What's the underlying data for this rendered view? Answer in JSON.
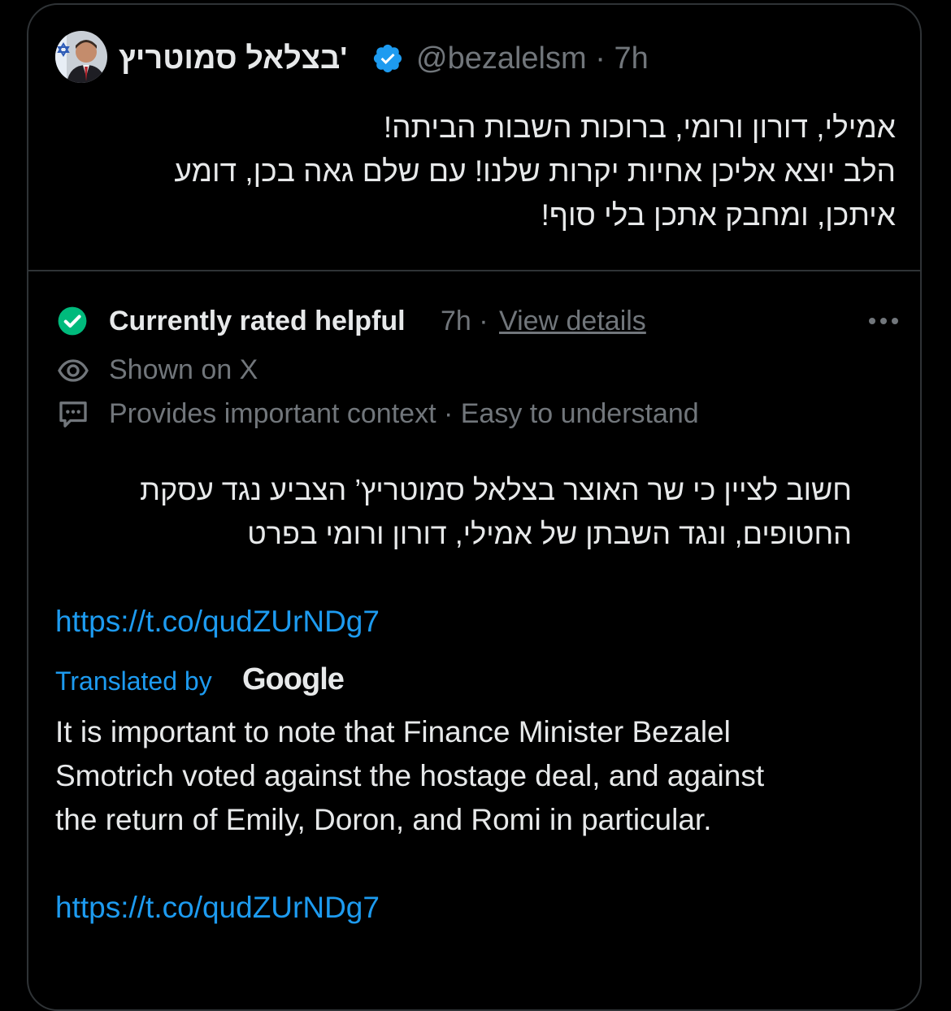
{
  "tweet": {
    "author_name": "בצלאל סמוטריץ'",
    "handle": "@bezalelsm",
    "separator": "·",
    "time": "7h",
    "text_lines": [
      "אמילי, דורון ורומי, ברוכות השבות הביתה!",
      "הלב יוצא אליכן אחיות יקרות שלנו! עם שלם גאה בכן, דומע",
      "איתכן, ומחבק אתכן בלי סוף!"
    ]
  },
  "community_note": {
    "status_label": "Currently rated helpful",
    "time": "7h",
    "separator": "·",
    "view_details_label": "View details",
    "shown_on_label": "Shown on X",
    "reasons_label": "Provides important context · Easy to understand",
    "note_lines_he": [
      "חשוב לציין כי שר האוצר בצלאל סמוטריץ’ הצביע נגד עסקת",
      "החטופים, ונגד השבתן של אמילי, דורון ורומי בפרט"
    ],
    "link_1": "https://t.co/qudZUrNDg7",
    "translated_by_label": "Translated by",
    "translator_logo_text": "Google",
    "translation_lines": [
      "It is important to note that Finance Minister Bezalel",
      "Smotrich voted against the hostage deal, and against",
      "the return of Emily, Doron, and Romi in particular."
    ],
    "link_2": "https://t.co/qudZUrNDg7"
  },
  "icons": {
    "verified": "verified-badge-icon",
    "rated_helpful": "check-circle-icon",
    "shown_on": "eye-icon",
    "reasons": "comment-dots-icon",
    "more": "more-horizontal-icon"
  },
  "colors": {
    "background": "#000000",
    "border": "#2f3336",
    "text_primary": "#e7e9ea",
    "text_secondary": "#71767b",
    "link": "#1d9bf0",
    "verified": "#1d9bf0",
    "helpful_green": "#00ba7c"
  }
}
